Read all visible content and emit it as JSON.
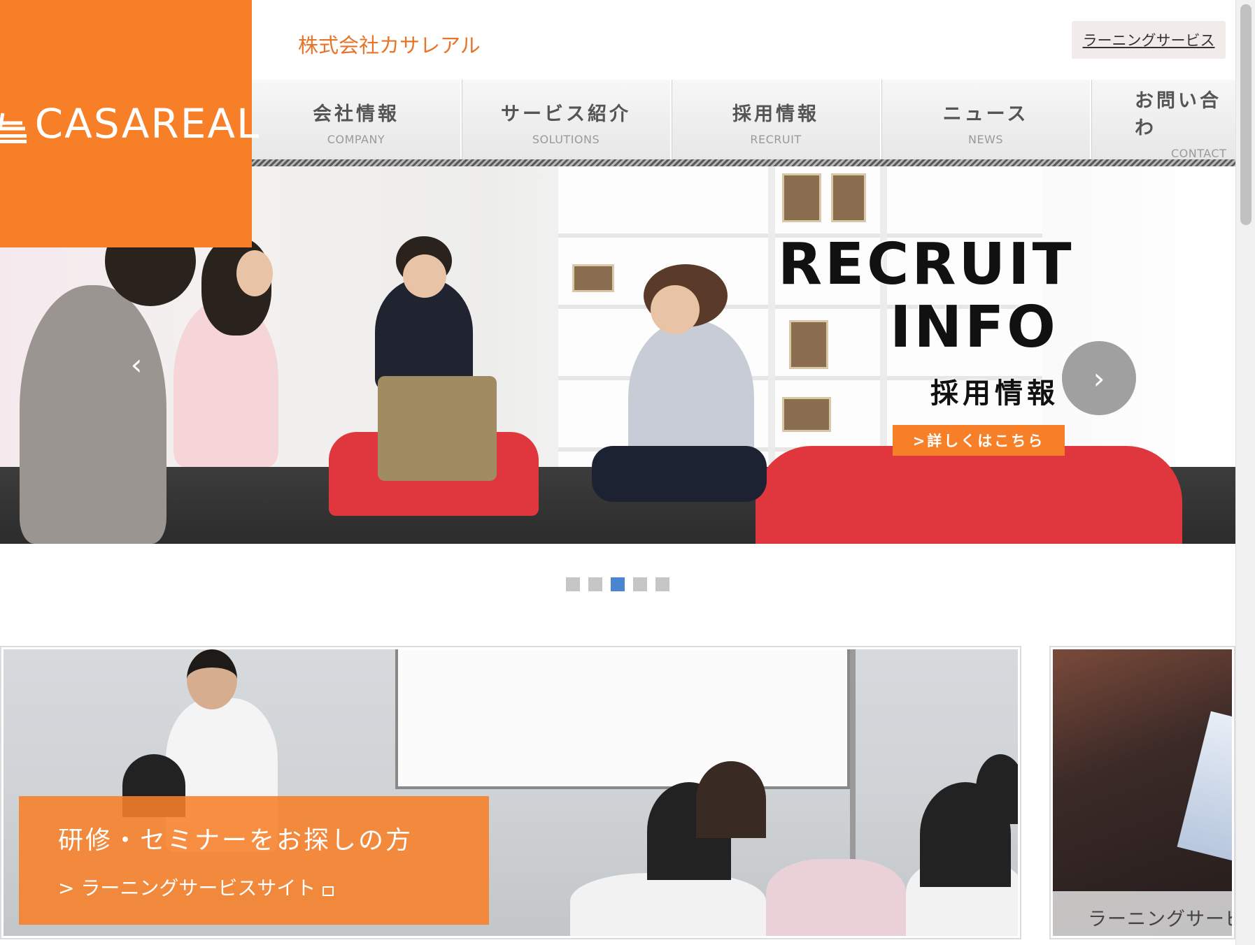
{
  "logo": {
    "text": "CASAREAL",
    "icon": "stacked-lines-logo-icon"
  },
  "header": {
    "company_name": "株式会社カサレアル",
    "learning_service_link": "ラーニングサービス"
  },
  "nav": {
    "items": [
      {
        "jp": "会社情報",
        "en": "COMPANY"
      },
      {
        "jp": "サービス紹介",
        "en": "SOLUTIONS"
      },
      {
        "jp": "採用情報",
        "en": "RECRUIT"
      },
      {
        "jp": "ニュース",
        "en": "NEWS"
      },
      {
        "jp": "お問い合わ",
        "en": "CONTACT"
      }
    ]
  },
  "hero": {
    "title_line1": "RECRUIT",
    "title_line2": "INFO",
    "subtitle_jp": "採用情報",
    "more_button": ">詳しくはこちら",
    "prev_icon": "chevron-left-icon",
    "next_icon": "chevron-right-icon",
    "prev_glyph": "‹",
    "next_glyph": "›"
  },
  "carousel": {
    "total": 5,
    "active_index": 2
  },
  "cards": [
    {
      "title": "研修・セミナーをお探しの方",
      "link": "> ラーニングサービスサイト",
      "link_icon": "external-link-icon"
    },
    {
      "label": "ラーニングサービ"
    }
  ],
  "colors": {
    "accent": "#f77f28",
    "company_name": "#e8742a",
    "dot_active": "#4a86d0",
    "dot_inactive": "#c6c6c6"
  }
}
